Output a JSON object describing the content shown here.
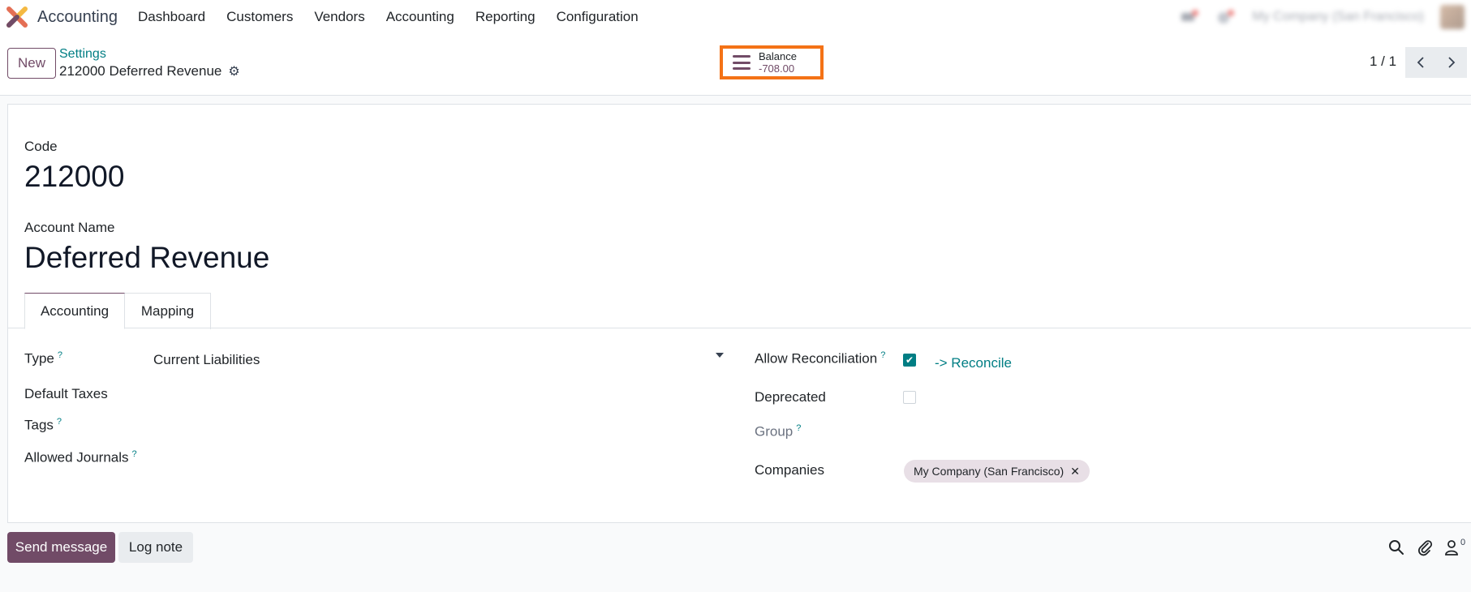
{
  "navbar": {
    "app_name": "Accounting",
    "menu": [
      "Dashboard",
      "Customers",
      "Vendors",
      "Accounting",
      "Reporting",
      "Configuration"
    ],
    "company": "My Company (San Francisco)",
    "icons": [
      "chat-icon",
      "activity-icon"
    ]
  },
  "control_panel": {
    "new_label": "New",
    "breadcrumb": "Settings",
    "record_title": "212000 Deferred Revenue",
    "balance": {
      "label": "Balance",
      "value": "-708.00"
    },
    "pager": "1 / 1"
  },
  "form": {
    "code_label": "Code",
    "code_value": "212000",
    "name_label": "Account Name",
    "name_value": "Deferred Revenue",
    "tabs": [
      "Accounting",
      "Mapping"
    ],
    "left_fields": {
      "type_label": "Type",
      "type_value": "Current Liabilities",
      "default_taxes_label": "Default Taxes",
      "tags_label": "Tags",
      "allowed_journals_label": "Allowed Journals"
    },
    "right_fields": {
      "allow_reconciliation_label": "Allow Reconciliation",
      "allow_reconciliation_checked": true,
      "reconcile_link": "-> Reconcile",
      "deprecated_label": "Deprecated",
      "deprecated_checked": false,
      "group_label": "Group",
      "companies_label": "Companies",
      "companies_tag": "My Company (San Francisco)"
    },
    "help_marker": "?"
  },
  "chatter": {
    "send_label": "Send message",
    "log_label": "Log note",
    "followers": "0"
  },
  "colors": {
    "brand": "#714b67",
    "link": "#017e84",
    "highlight": "#f47216"
  }
}
